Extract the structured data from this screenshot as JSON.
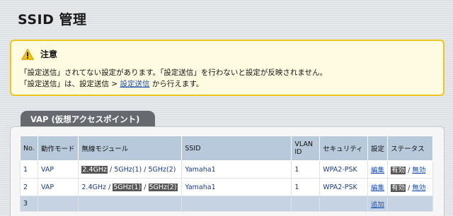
{
  "page_title": "SSID 管理",
  "notice": {
    "title": "注意",
    "line1": "「設定送信」されてない設定があります。「設定送信」を行わないと設定が反映されません。",
    "line2_prefix": "「設定送信」は、設定送信 > ",
    "line2_link": "設定送信",
    "line2_suffix": " から行えます。",
    "icon": "warning-icon"
  },
  "tab_label": "VAP (仮想アクセスポイント)",
  "table": {
    "headers": [
      "No.",
      "動作モード",
      "無線モジュール",
      "SSID",
      "VLAN ID",
      "セキュリティ",
      "設定",
      "ステータス"
    ],
    "rows": [
      {
        "no": "1",
        "mode": "VAP",
        "mod_a": "2.4GHz",
        "mod_b": "5GHz(1)",
        "mod_c": "5GHz(2)",
        "ssid": "Yamaha1",
        "vlan": "1",
        "security": "WPA2-PSK",
        "edit": "編集",
        "status_on": "有効",
        "status_off": "無効"
      },
      {
        "no": "2",
        "mode": "VAP",
        "mod_a": "2.4GHz",
        "mod_b": "5GHz(1)",
        "mod_c": "5GHz(2)",
        "ssid": "Yamaha1",
        "vlan": "1",
        "security": "WPA2-PSK",
        "edit": "編集",
        "status_on": "有効",
        "status_off": "無効"
      }
    ],
    "empty_row": {
      "no": "3",
      "add": "追加"
    },
    "separator": " / "
  },
  "colors": {
    "notice_border": "#f0c419",
    "notice_bg": "#fffbe0",
    "header_bg": "#b8c9dc",
    "link": "#1a4fb5",
    "tab_bg": "#666a70"
  }
}
